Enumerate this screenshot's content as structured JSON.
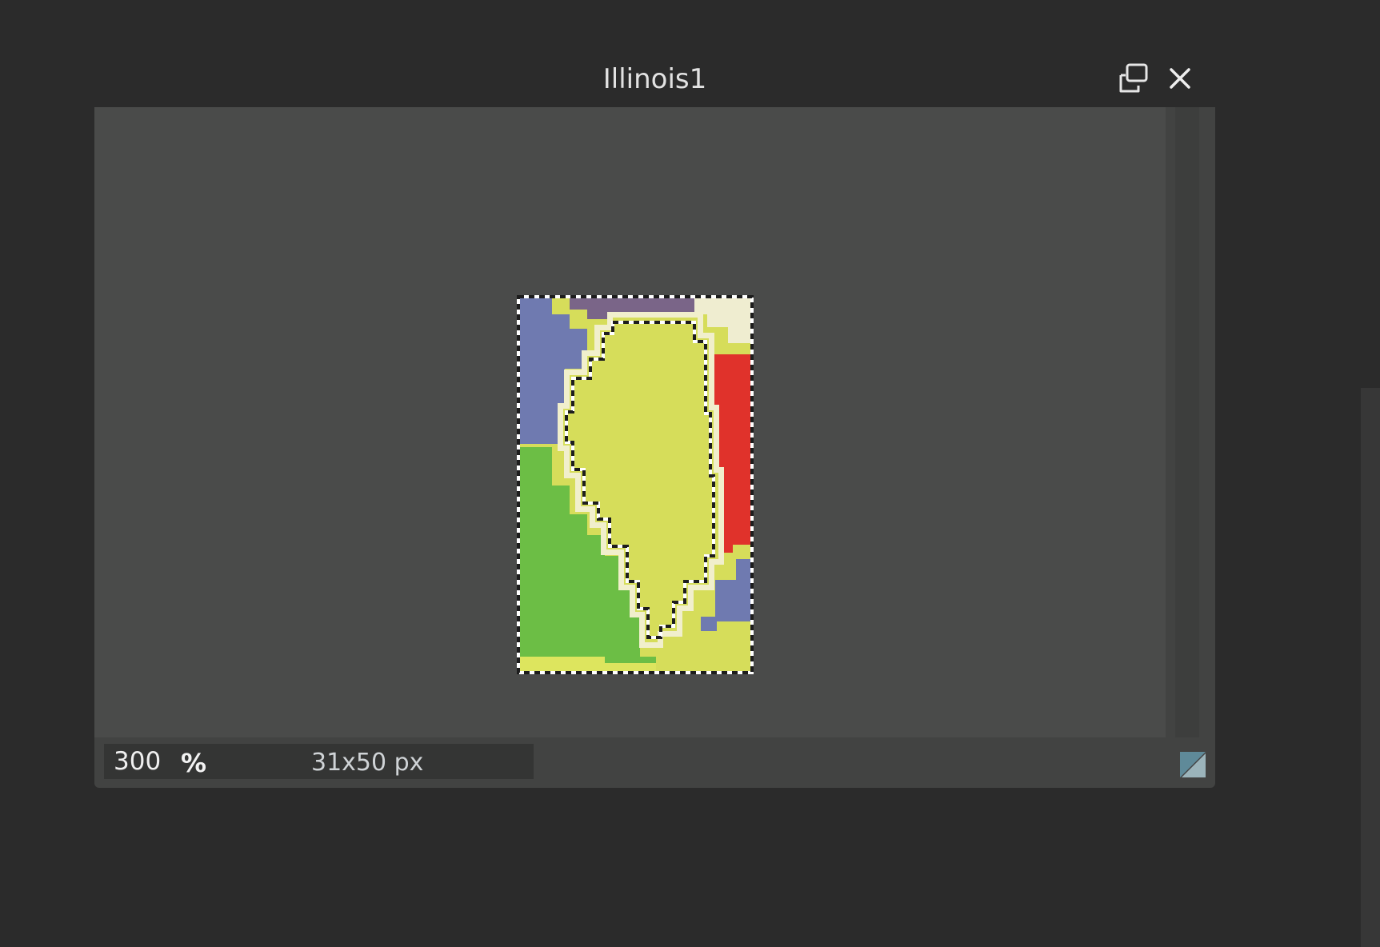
{
  "window": {
    "title": "Illinois1"
  },
  "status": {
    "zoom_value": "300",
    "zoom_unit": "%",
    "image_size": "31x50 px"
  },
  "icons": {
    "restore": "restore-window-icon",
    "close": "close-icon",
    "resize": "resize-grip-icon"
  },
  "colors": {
    "illinois_yellow": "#d6dd5a",
    "outline_cream": "#f1efcc",
    "west_blue": "#6f7ab0",
    "north_purple": "#7a6588",
    "indiana_red": "#e0322b",
    "missouri_green": "#6cbe45",
    "canvas_bg": "#4a4b4a"
  }
}
